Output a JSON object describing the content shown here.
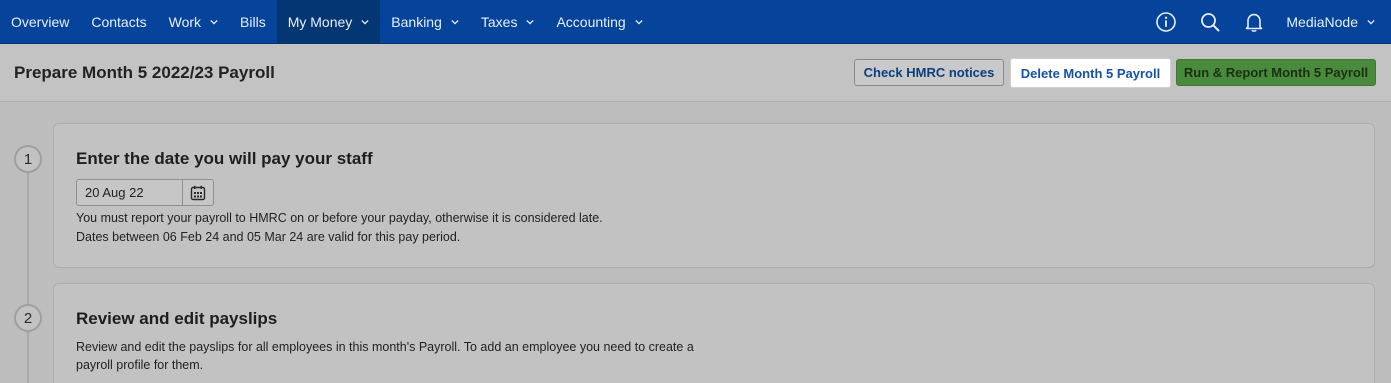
{
  "nav": {
    "items": [
      {
        "label": "Overview",
        "dropdown": false
      },
      {
        "label": "Contacts",
        "dropdown": false
      },
      {
        "label": "Work",
        "dropdown": true
      },
      {
        "label": "Bills",
        "dropdown": false
      },
      {
        "label": "My Money",
        "dropdown": true,
        "active": true
      },
      {
        "label": "Banking",
        "dropdown": true
      },
      {
        "label": "Taxes",
        "dropdown": true
      },
      {
        "label": "Accounting",
        "dropdown": true
      }
    ],
    "icons": [
      "info-icon",
      "search-icon",
      "bell-icon"
    ],
    "user": "MediaNode"
  },
  "header": {
    "title": "Prepare Month 5 2022/23 Payroll",
    "check_hmrc_label": "Check HMRC notices",
    "delete_label": "Delete Month 5 Payroll",
    "run_label": "Run & Report Month 5 Payroll"
  },
  "steps": [
    {
      "number": "1",
      "title": "Enter the date you will pay your staff",
      "date_value": "20 Aug 22",
      "text_line1": "You must report your payroll to HMRC on or before your payday, otherwise it is considered late.",
      "text_line2": "Dates between 06 Feb 24 and 05 Mar 24 are valid for this pay period."
    },
    {
      "number": "2",
      "title": "Review and edit payslips",
      "text_line1": "Review and edit the payslips for all employees in this month's Payroll. To add an employee you need to create a",
      "text_line2": "payroll profile for them."
    }
  ],
  "colors": {
    "nav_bg": "#05449a",
    "nav_active": "#033672",
    "run_button": "#4a8a3c",
    "delete_button_bg": "#ffffff"
  }
}
